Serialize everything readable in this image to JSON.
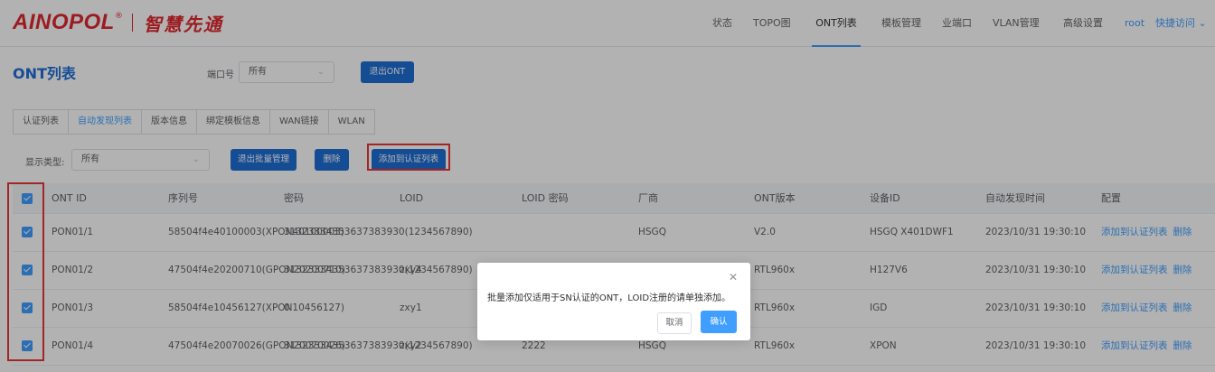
{
  "brand": {
    "name": "AINOPOL",
    "reg": "®",
    "subtitle": "智慧先通"
  },
  "nav": {
    "items": [
      "状态",
      "TOPO图",
      "ONT列表",
      "模板管理",
      "业端口",
      "VLAN管理",
      "高级设置"
    ],
    "active": "ONT列表",
    "user": "root",
    "quick": "快捷访问",
    "chevron_icon": "chevron-down-icon"
  },
  "page": {
    "title": "ONT列表",
    "port_label": "端口号",
    "port_value": "所有",
    "exit_button": "退出ONT"
  },
  "tabs": [
    "认证列表",
    "自动发现列表",
    "版本信息",
    "绑定模板信息",
    "WAN链接",
    "WLAN"
  ],
  "active_tab": "自动发现列表",
  "filter": {
    "show_label": "显示类型:",
    "show_value": "所有",
    "exit_batch": "退出批量管理",
    "delete": "删除",
    "add_to_auth": "添加到认证列表"
  },
  "table": {
    "headers": [
      "ONT ID",
      "序列号",
      "密码",
      "LOID",
      "LOID 密码",
      "厂商",
      "ONT版本",
      "设备ID",
      "自动发现时间",
      "配置"
    ],
    "rows": [
      {
        "ont_id": "PON01/1",
        "serial": "58504f4e40100003(XPON40100003)",
        "password": "31323334353637383930(1234567890)",
        "loid": "",
        "loid_pwd": "",
        "vendor": "HSGQ",
        "version": "V2.0",
        "device_id": "HSGQ X401DWF1",
        "time": "2023/10/31 19:30:10"
      },
      {
        "ont_id": "PON01/2",
        "serial": "47504f4e20200710(GPON20200710)",
        "password": "31323334353637383930(1234567890)",
        "loid": "zxy4",
        "loid_pwd": "",
        "vendor": "",
        "version": "RTL960x",
        "device_id": "H127V6",
        "time": "2023/10/31 19:30:10"
      },
      {
        "ont_id": "PON01/3",
        "serial": "58504f4e10456127(XPON10456127)",
        "password": "0",
        "loid": "zxy1",
        "loid_pwd": "",
        "vendor": "",
        "version": "RTL960x",
        "device_id": "IGD",
        "time": "2023/10/31 19:30:10"
      },
      {
        "ont_id": "PON01/4",
        "serial": "47504f4e20070026(GPON20070026)",
        "password": "31323334353637383930(1234567890)",
        "loid": "zxy2",
        "loid_pwd": "2222",
        "vendor": "HSGQ",
        "version": "RTL960x",
        "device_id": "XPON",
        "time": "2023/10/31 19:30:10"
      }
    ],
    "action_add": "添加到认证列表",
    "action_delete": "删除"
  },
  "dialog": {
    "message": "批量添加仅适用于SN认证的ONT，LOID注册的请单独添加。",
    "cancel": "取消",
    "ok": "确认",
    "close_icon": "close-icon"
  },
  "colors": {
    "brand_red": "#e0282e",
    "primary": "#409eff",
    "highlight_box": "#e53935"
  }
}
